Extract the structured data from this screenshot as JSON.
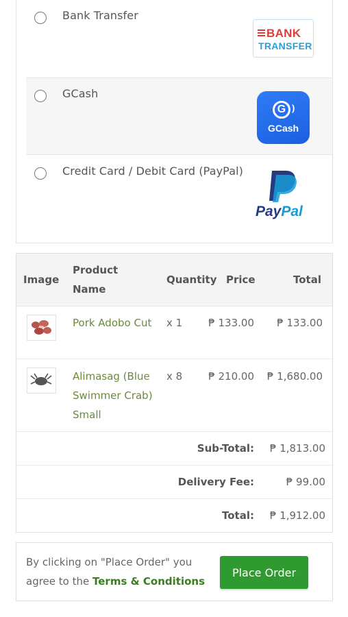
{
  "payment_methods": [
    {
      "label": "Bank Transfer",
      "logo": "bank-transfer-logo",
      "logo_text": [
        "BANK",
        "TRANSFER"
      ]
    },
    {
      "label": "GCash",
      "logo": "gcash-logo",
      "logo_text": [
        "G",
        "GCash"
      ]
    },
    {
      "label": "Credit Card / Debit Card (PayPal)",
      "logo": "paypal-logo",
      "logo_text": [
        "Pay",
        "Pal"
      ]
    }
  ],
  "table": {
    "headers": {
      "image": "Image",
      "product": "Product Name",
      "quantity": "Quantity",
      "price": "Price",
      "total": "Total"
    },
    "rows": [
      {
        "name": "Pork Adobo Cut",
        "qty": "x 1",
        "price": "₱ 133.00",
        "total": "₱ 133.00"
      },
      {
        "name": "Alimasag (Blue Swimmer Crab) Small",
        "qty": "x 8",
        "price": "₱ 210.00",
        "total": "₱ 1,680.00"
      }
    ],
    "summary": [
      {
        "label": "Sub-Total:",
        "value": "₱ 1,813.00"
      },
      {
        "label": "Delivery Fee:",
        "value": "₱ 99.00"
      },
      {
        "label": "Total:",
        "value": "₱ 1,912.00"
      }
    ]
  },
  "order": {
    "prefix": "By clicking on \"Place Order\" you agree to the",
    "terms_link": "Terms & Conditions",
    "button": "Place Order"
  },
  "colors": {
    "accent_green": "#2f9a2f",
    "link_green": "#3c7d22",
    "product_green": "#6c8a3c"
  }
}
